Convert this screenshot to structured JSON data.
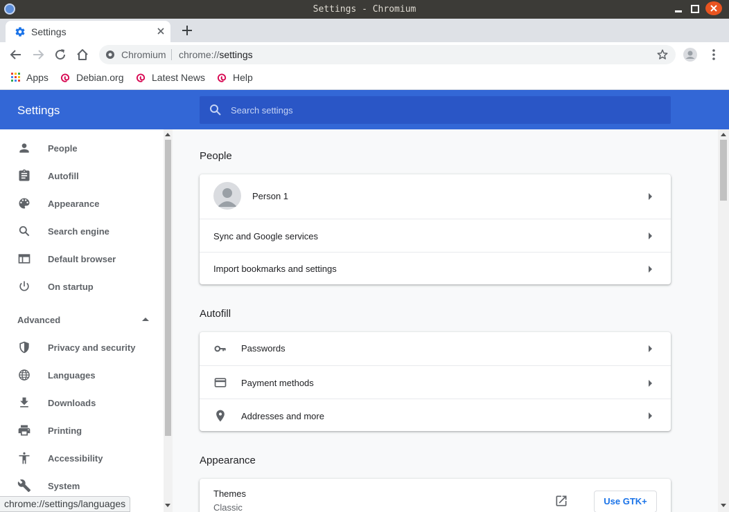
{
  "window": {
    "title": "Settings - Chromium"
  },
  "tab": {
    "title": "Settings"
  },
  "omnibox": {
    "site_name": "Chromium",
    "url_scheme": "chrome://",
    "url_path": "settings"
  },
  "bookmarks": [
    {
      "label": "Apps",
      "icon": "apps-grid-icon"
    },
    {
      "label": "Debian.org",
      "icon": "debian-swirl-icon"
    },
    {
      "label": "Latest News",
      "icon": "debian-swirl-icon"
    },
    {
      "label": "Help",
      "icon": "debian-swirl-icon"
    }
  ],
  "colors": {
    "header_blue": "#3367d6",
    "search_blue": "#2a56c6",
    "link_blue": "#1a73e8",
    "close_orange": "#e95420"
  },
  "header": {
    "title": "Settings",
    "search_placeholder": "Search settings"
  },
  "sidebar": {
    "items": [
      {
        "label": "People",
        "icon": "person-icon"
      },
      {
        "label": "Autofill",
        "icon": "clipboard-icon"
      },
      {
        "label": "Appearance",
        "icon": "palette-icon"
      },
      {
        "label": "Search engine",
        "icon": "search-icon"
      },
      {
        "label": "Default browser",
        "icon": "browser-window-icon"
      },
      {
        "label": "On startup",
        "icon": "power-icon"
      }
    ],
    "advanced_label": "Advanced",
    "advanced_items": [
      {
        "label": "Privacy and security",
        "icon": "shield-icon"
      },
      {
        "label": "Languages",
        "icon": "globe-icon"
      },
      {
        "label": "Downloads",
        "icon": "download-icon"
      },
      {
        "label": "Printing",
        "icon": "printer-icon"
      },
      {
        "label": "Accessibility",
        "icon": "accessibility-icon"
      },
      {
        "label": "System",
        "icon": "wrench-icon"
      }
    ]
  },
  "main": {
    "people": {
      "title": "People",
      "person_name": "Person 1",
      "sync_label": "Sync and Google services",
      "import_label": "Import bookmarks and settings"
    },
    "autofill": {
      "title": "Autofill",
      "passwords_label": "Passwords",
      "payment_label": "Payment methods",
      "addresses_label": "Addresses and more"
    },
    "appearance": {
      "title": "Appearance",
      "themes_label": "Themes",
      "themes_value": "Classic",
      "gtk_button": "Use GTK+"
    }
  },
  "status_bar": {
    "url": "chrome://settings/languages"
  }
}
